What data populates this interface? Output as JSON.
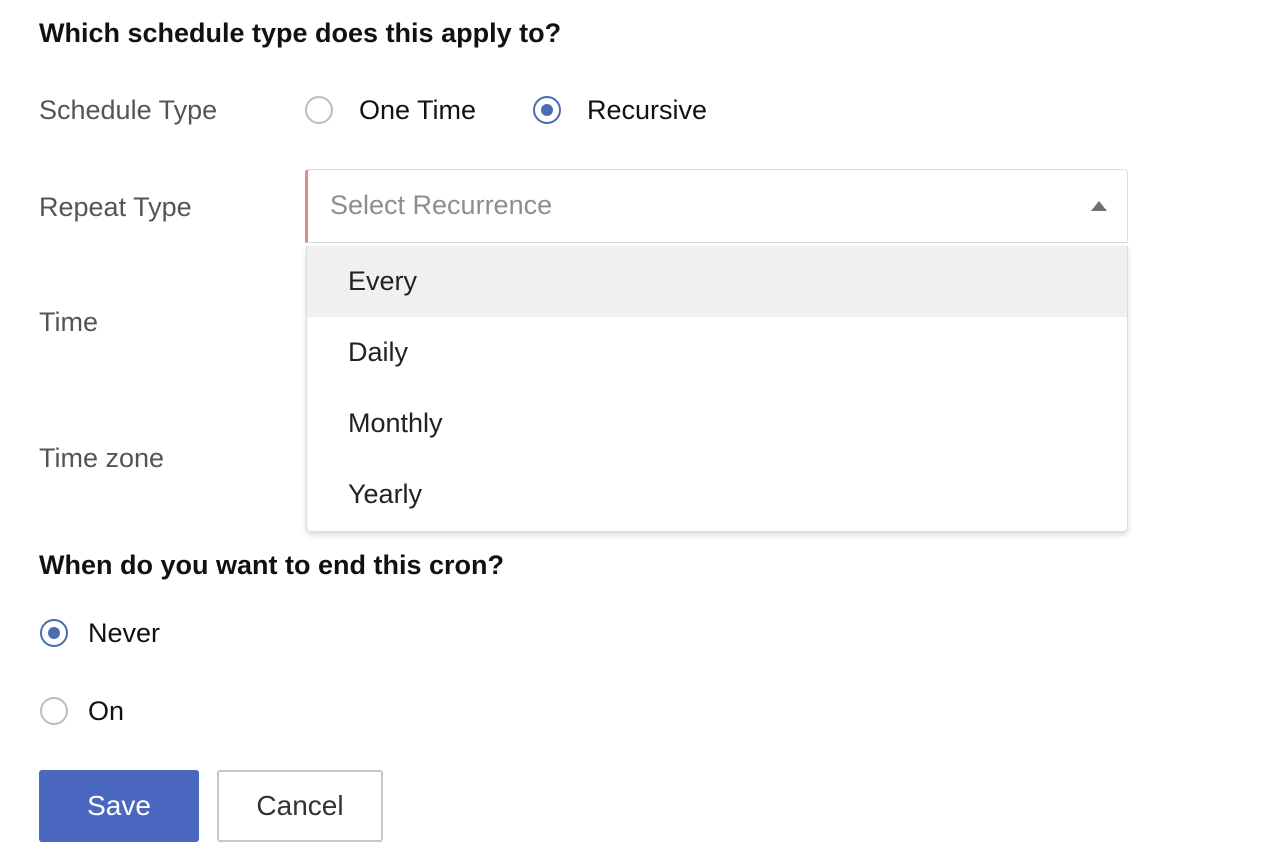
{
  "section1": {
    "heading": "Which schedule type does this apply to?",
    "schedule_type": {
      "label": "Schedule Type",
      "options": [
        {
          "label": "One Time",
          "checked": false
        },
        {
          "label": "Recursive",
          "checked": true
        }
      ]
    },
    "repeat_type": {
      "label": "Repeat Type",
      "placeholder": "Select Recurrence",
      "open": true,
      "options": [
        "Every",
        "Daily",
        "Monthly",
        "Yearly"
      ],
      "highlighted": "Every"
    },
    "time": {
      "label": "Time"
    },
    "time_zone": {
      "label": "Time zone"
    }
  },
  "section2": {
    "heading": "When do you want to end this cron?",
    "options": [
      {
        "label": "Never",
        "checked": true
      },
      {
        "label": "On",
        "checked": false
      }
    ]
  },
  "buttons": {
    "save_label": "Save",
    "cancel_label": "Cancel"
  },
  "colors": {
    "accent": "#4a68c0",
    "radio_checked": "#4a6cb3",
    "required_indicator": "#e08a8a"
  }
}
